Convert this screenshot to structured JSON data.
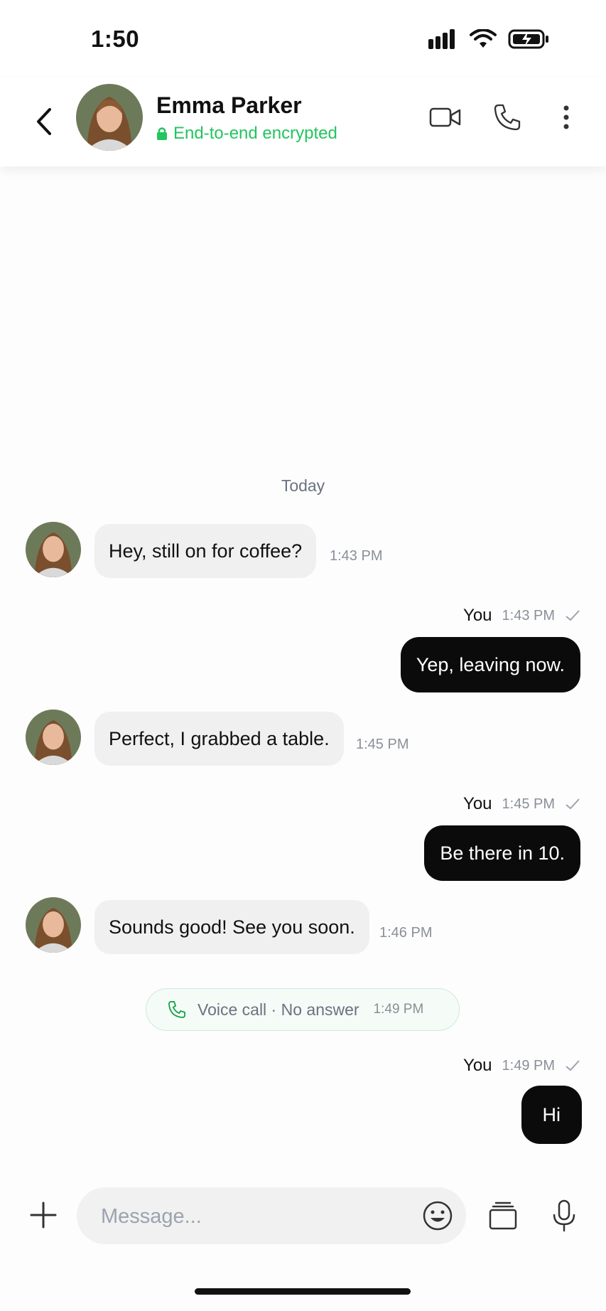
{
  "status_bar": {
    "time": "1:50"
  },
  "header": {
    "contact_name": "Emma Parker",
    "encryption_label": "End-to-end encrypted",
    "accent_color": "#22c55e"
  },
  "chat": {
    "date_divider": "Today",
    "messages": [
      {
        "direction": "in",
        "text": "Hey, still on for coffee?",
        "time": "1:43 PM"
      },
      {
        "direction": "out",
        "sender": "You",
        "text": "Yep, leaving now.",
        "time": "1:43 PM"
      },
      {
        "direction": "in",
        "text": "Perfect, I grabbed a table.",
        "time": "1:45 PM"
      },
      {
        "direction": "out",
        "sender": "You",
        "text": "Be there in 10.",
        "time": "1:45 PM"
      },
      {
        "direction": "in",
        "text": "Sounds good! See you soon.",
        "time": "1:46 PM"
      },
      {
        "direction": "out",
        "sender": "You",
        "text": "Hi",
        "time": "1:49 PM"
      }
    ],
    "call_event": {
      "text": "Voice call · No answer",
      "time": "1:49 PM"
    }
  },
  "composer": {
    "placeholder": "Message..."
  },
  "icons": [
    "back-icon",
    "video-call-icon",
    "phone-icon",
    "more-icon",
    "lock-icon",
    "checkmark-icon",
    "plus-icon",
    "emoji-icon",
    "stack-icon",
    "mic-icon",
    "signal-icon",
    "wifi-icon",
    "battery-charging-icon"
  ]
}
